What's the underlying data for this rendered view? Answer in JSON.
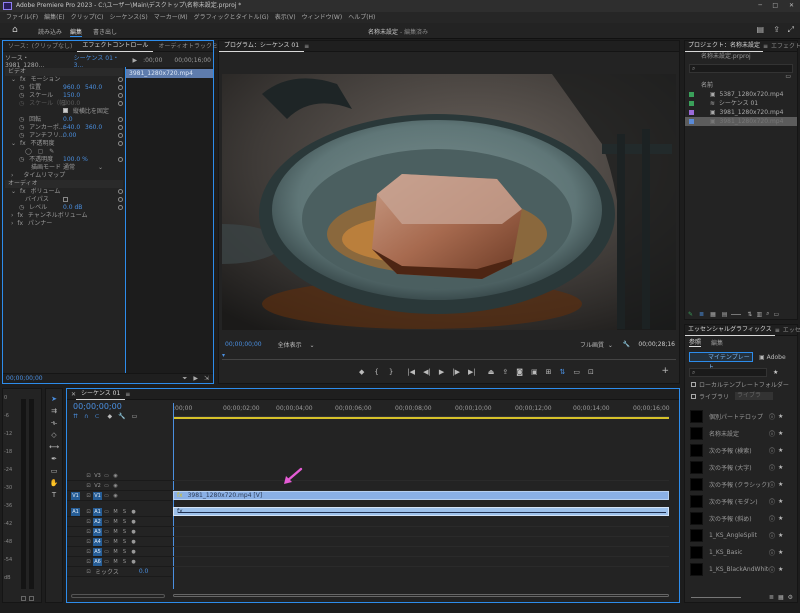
{
  "titlebar": {
    "app_title": "Adobe Premiere Pro 2023 - C:\\ユーザー\\Main\\デスクトップ\\名称未設定.prproj *"
  },
  "menu": [
    "ファイル(F)",
    "編集(E)",
    "クリップ(C)",
    "シーケンス(S)",
    "マーカー(M)",
    "グラフィックとタイトル(G)",
    "表示(V)",
    "ウィンドウ(W)",
    "ヘルプ(H)"
  ],
  "workspace": {
    "tabs": [
      "読み込み",
      "編集",
      "書き出し"
    ],
    "active": "編集",
    "project_name": "名称未設定",
    "status": "- 編集済み"
  },
  "effect_controls": {
    "tabs": [
      "ソース：(クリップなし)",
      "エフェクトコントロール",
      "オーディオトラックミキサ"
    ],
    "source_label": "ソース・3981_1280...",
    "seq_label": "シーケンス 01・3...",
    "clip_label": "3981_1280x720.mp4",
    "timecode_start": ":00;00",
    "timecode_mid": "00;00;16;00",
    "section_video": "ビデオ",
    "motion": "モーション",
    "position_label": "位置",
    "position_x": "960.0",
    "position_y": "540.0",
    "scale_label": "スケール",
    "scale_val": "150.0",
    "scale_w_label": "スケール（幅）",
    "scale_w_val": "100.0",
    "uniform_label": "縦横比を固定",
    "rotation_label": "回転",
    "rotation_val": "0.0",
    "anchor_label": "アンカーポ...",
    "anchor_x": "640.0",
    "anchor_y": "360.0",
    "antiflicker_label": "アンチフリ...",
    "antiflicker_val": "0.00",
    "opacity": "不透明度",
    "opacity_label": "不透明度",
    "opacity_val": "100.0 %",
    "blend_label": "描画モード",
    "blend_val": "通常",
    "time_remap": "タイムリマップ",
    "section_audio": "オーディオ",
    "volume": "ボリューム",
    "bypass_label": "バイパス",
    "level_label": "レベル",
    "level_val": "0.0 dB",
    "channel_volume": "チャンネルボリューム",
    "panner": "パンナー",
    "footer_tc": "00;00;00;00"
  },
  "program": {
    "title": "プログラム：シーケンス 01",
    "timecode": "00;00;00;00",
    "fit": "全体表示",
    "quality": "フル画質",
    "duration": "00;00;28;16"
  },
  "project": {
    "tabs": [
      "プロジェクト：名称未設定",
      "エフェクト"
    ],
    "file": "名称未設定.prproj",
    "column_name": "名前",
    "items": [
      {
        "name": "5387_1280x720.mp4",
        "color": "#3aa05a"
      },
      {
        "name": "シーケンス 01",
        "color": "#3aa05a"
      },
      {
        "name": "3981_1280x720.mp4",
        "color": "#9a6ad8"
      },
      {
        "name": "3981_1280x720.mp4",
        "color": "#5a8ad8"
      }
    ]
  },
  "essential_graphics": {
    "tabs": [
      "エッセンシャルグラフィックス",
      "エッセ"
    ],
    "subtabs": [
      "参照",
      "編集"
    ],
    "my_templates": "マイテンプレート",
    "adobe_label": "Adobe",
    "local_folder": "ローカルテンプレートフォルダー",
    "library": "ライブラリ",
    "library_select": "ライブラ",
    "items": [
      "個別パートテロップ",
      "名称未設定",
      "次の予報 (検索)",
      "次の予報 (大字)",
      "次の予報 (クラシック)",
      "次の予報 (モダン)",
      "次の予報 (斜め)",
      "1_KS_AngleSplit",
      "1_KS_Basic",
      "1_KS_BlackAndWhite"
    ]
  },
  "timeline": {
    "title": "シーケンス 01",
    "timecode": "00;00;00;00",
    "ruler": [
      ":00;00",
      "00;00;02;00",
      "00;00;04;00",
      "00;00;06;00",
      "00;00;08;00",
      "00;00;10;00",
      "00;00;12;00",
      "00;00;14;00",
      "00;00;16;00"
    ],
    "video_tracks": [
      "V3",
      "V2",
      "V1"
    ],
    "audio_tracks": [
      "A1",
      "A2",
      "A3",
      "A4",
      "A5",
      "A6"
    ],
    "src_v": "V1",
    "src_a": "A1",
    "mix_label": "ミックス",
    "mix_val": "0.0",
    "video_clip": "3981_1280x720.mp4 [V]",
    "audio_clip_icon": "fx"
  },
  "meters": [
    "0",
    "-6",
    "-12",
    "-18",
    "-24",
    "-30",
    "-36",
    "-42",
    "-48",
    "-54",
    "dB"
  ],
  "colors": {
    "accent": "#2d8ceb",
    "timecode": "#4a8fe0",
    "arrow": "#e55bd5"
  }
}
